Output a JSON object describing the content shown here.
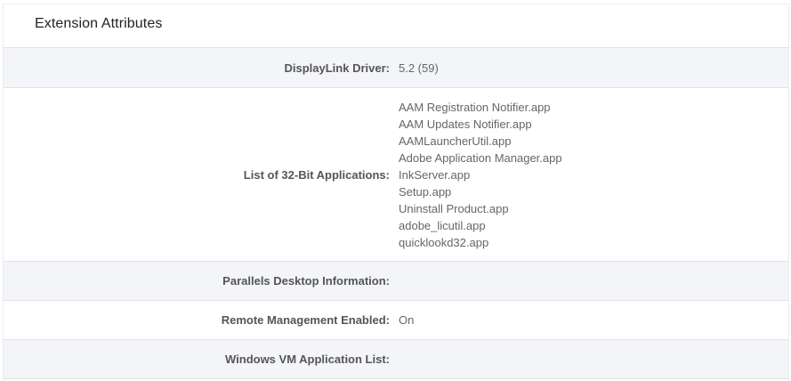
{
  "section": {
    "title": "Extension Attributes"
  },
  "rows": {
    "displaylink": {
      "label": "DisplayLink Driver:",
      "value": "5.2 (59)"
    },
    "apps32": {
      "label": "List of 32-Bit Applications:",
      "values": [
        "AAM Registration Notifier.app",
        "AAM Updates Notifier.app",
        "AAMLauncherUtil.app",
        "Adobe Application Manager.app",
        "InkServer.app",
        "Setup.app",
        "Uninstall Product.app",
        "adobe_licutil.app",
        "quicklookd32.app"
      ]
    },
    "parallels": {
      "label": "Parallels Desktop Information:",
      "value": ""
    },
    "remote": {
      "label": "Remote Management Enabled:",
      "value": "On"
    },
    "windowsvm": {
      "label": "Windows VM Application List:",
      "value": ""
    }
  }
}
